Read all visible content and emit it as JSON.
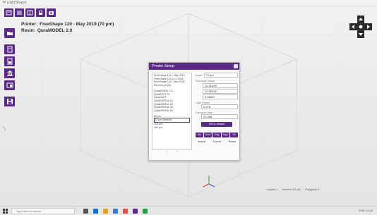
{
  "window": {
    "title": "Ψ LightShape"
  },
  "toolbar": {
    "icons": [
      "new-file-icon",
      "list-view-icon",
      "layout-icon",
      "settings-icon",
      "camera-icon"
    ]
  },
  "left_toolbar": {
    "icons": [
      "open-folder-icon",
      "document-icon",
      "file-icon",
      "support-icon",
      "export-icon",
      "save-icon"
    ]
  },
  "info": {
    "printer_label": "Printer:",
    "printer_value": "FreeShape 120 - May 2019 (70 µm)",
    "resin_label": "Resin:",
    "resin_value": "QuraMODEL 2.0"
  },
  "dialog": {
    "title": "Printer Setup",
    "list_printers": [
      "FreeShape 120 - May 2019",
      "FreeShape 120 v1.0 2018",
      "FreeShape 120 - Nov 2018",
      "Recovery 0120"
    ],
    "list_resins": [
      "QuraMODEL 2.0",
      "QuraSOFT 01",
      "QuraCAST",
      "QuraDENTAL A1",
      "QuraDENTAL A2",
      "QuraDENTAL A3",
      "QuraDENTAL B1"
    ],
    "list_layers": [
      "50 µm",
      "70 µm (default)",
      "100 µm",
      "150 µm"
    ],
    "pager_prev": "‹",
    "pager_next": "›",
    "layer_label": "Layer",
    "layer_value": "70 µm",
    "exposure_label": "Exposure Setup",
    "exp_values": [
      "12.91499",
      "12.89336",
      "0.93227"
    ],
    "light_label": "Light Power",
    "light_value": "0.076",
    "time_label": "Exposure time",
    "time_value": "22.068",
    "calibrate_label": "Set to default",
    "btns": [
      "Min",
      "Norm",
      "Diag",
      "Supp",
      "Off"
    ],
    "import_label": "Import",
    "export_label": "Export",
    "reset_label": "Reset"
  },
  "status": {
    "layers": "Layers 1",
    "volume": "Volume 0.0 mL",
    "polygons": "Polygons 0"
  },
  "taskbar": {
    "search_placeholder": "Type here to search",
    "tray": "ENG 12:15"
  },
  "colors": {
    "accent": "#5a2a86",
    "background": "#ececec"
  }
}
